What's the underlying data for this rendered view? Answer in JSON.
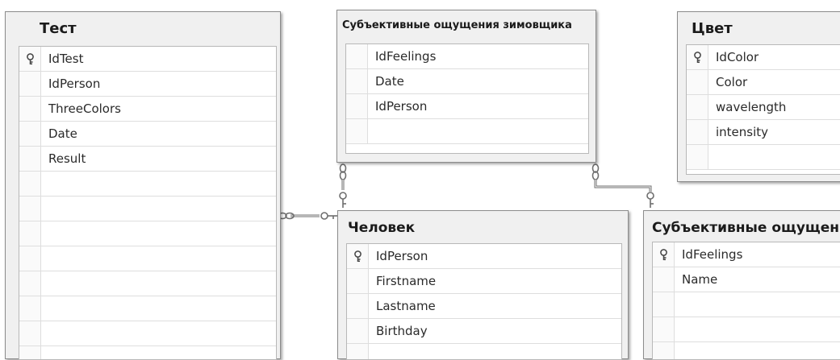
{
  "tables": {
    "test": {
      "title": "Тест",
      "columns": [
        {
          "name": "IdTest",
          "key": true
        },
        {
          "name": "IdPerson",
          "key": false
        },
        {
          "name": "ThreeColors",
          "key": false
        },
        {
          "name": "Date",
          "key": false
        },
        {
          "name": "Result",
          "key": false
        }
      ]
    },
    "feelings_winter": {
      "title": "Субъективные ощущения зимовщика",
      "columns": [
        {
          "name": "IdFeelings",
          "key": false
        },
        {
          "name": "Date",
          "key": false
        },
        {
          "name": "IdPerson",
          "key": false
        }
      ]
    },
    "color": {
      "title": "Цвет",
      "columns": [
        {
          "name": "IdColor",
          "key": true
        },
        {
          "name": "Color",
          "key": false
        },
        {
          "name": "wavelength",
          "key": false
        },
        {
          "name": "intensity",
          "key": false
        }
      ]
    },
    "person": {
      "title": "Человек",
      "columns": [
        {
          "name": "IdPerson",
          "key": true
        },
        {
          "name": "Firstname",
          "key": false
        },
        {
          "name": "Lastname",
          "key": false
        },
        {
          "name": "Birthday",
          "key": false
        }
      ]
    },
    "feelings": {
      "title": "Субъективные ощущения",
      "columns": [
        {
          "name": "IdFeelings",
          "key": true
        },
        {
          "name": "Name",
          "key": false
        }
      ]
    }
  },
  "colors": {
    "box_bg": "#f0f0f0",
    "grid_bg": "#ffffff",
    "border": "#8c8c8c",
    "link": "#707070"
  },
  "icons": {
    "primary_key": "key-icon",
    "relationship_many": "infinity-icon",
    "relationship_one": "key-icon"
  }
}
